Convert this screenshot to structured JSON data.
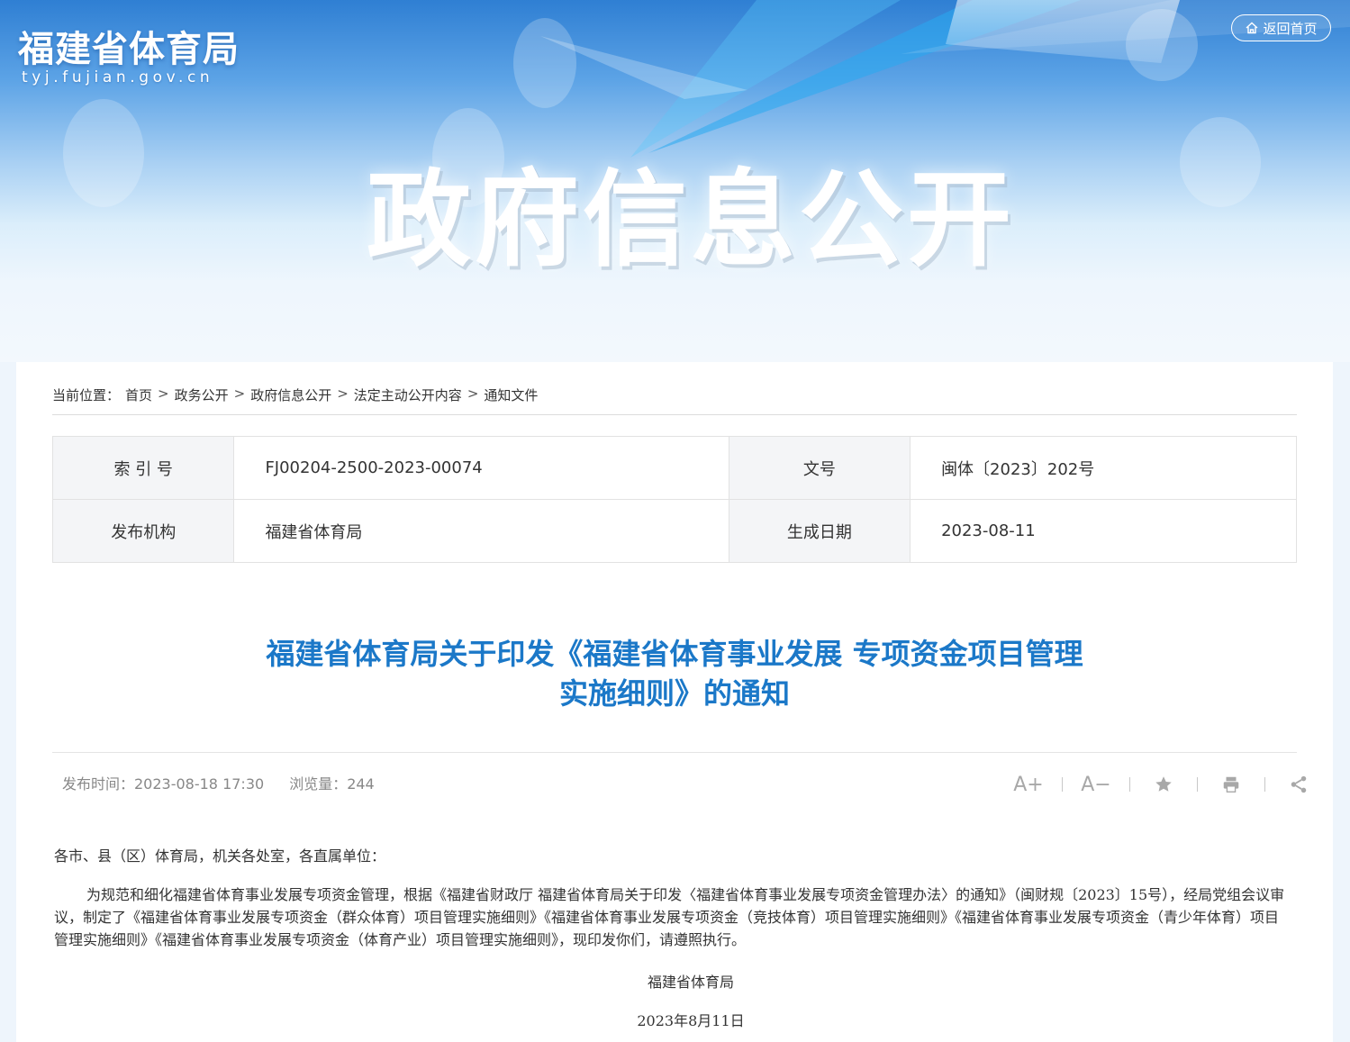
{
  "header": {
    "site_name": "福建省体育局",
    "site_domain": "tyj.fujian.gov.cn",
    "home_button": "返回首页",
    "hero_title": "政府信息公开"
  },
  "breadcrumb": {
    "label": "当前位置：",
    "items": [
      "首页",
      "政务公开",
      "政府信息公开",
      "法定主动公开内容",
      "通知文件"
    ],
    "separator": ">"
  },
  "meta": {
    "index_label": "索 引 号",
    "index_value": "FJ00204-2500-2023-00074",
    "docno_label": "文号",
    "docno_value": "闽体〔2023〕202号",
    "org_label": "发布机构",
    "org_value": "福建省体育局",
    "date_label": "生成日期",
    "date_value": "2023-08-11"
  },
  "article": {
    "title_line1": "福建省体育局关于印发《福建省体育事业发展 专项资金项目管理",
    "title_line2": "实施细则》的通知",
    "publish_time": "发布时间：2023-08-18 17:30",
    "views": "浏览量：244",
    "greeting": "各市、县（区）体育局，机关各处室，各直属单位：",
    "paragraph": "为规范和细化福建省体育事业发展专项资金管理，根据《福建省财政厅 福建省体育局关于印发〈福建省体育事业发展专项资金管理办法〉的通知》（闽财规〔2023〕15号），经局党组会议审议，制定了《福建省体育事业发展专项资金（群众体育）项目管理实施细则》《福建省体育事业发展专项资金（竞技体育）项目管理实施细则》《福建省体育事业发展专项资金（青少年体育）项目管理实施细则》《福建省体育事业发展专项资金（体育产业）项目管理实施细则》，现印发你们，请遵照执行。",
    "signature": "福建省体育局",
    "sign_date": "2023年8月11日"
  },
  "tools": {
    "font_increase": "A+",
    "font_decrease": "A−"
  },
  "colors": {
    "title_blue": "#1b78c8",
    "meta_key_bg": "#f4f5f7"
  }
}
